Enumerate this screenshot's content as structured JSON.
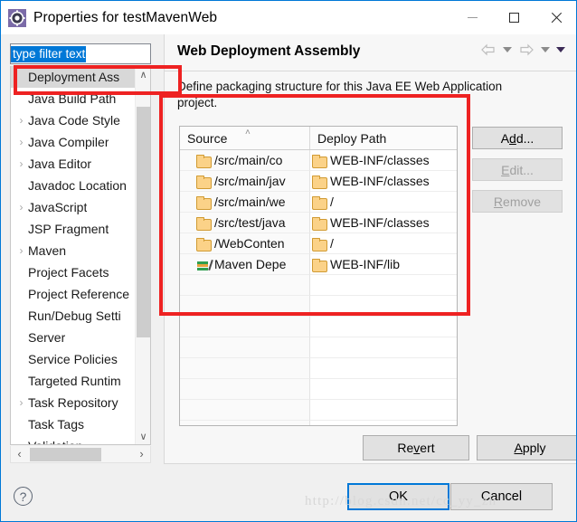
{
  "window": {
    "title": "Properties for testMavenWeb",
    "icon": "gear-icon",
    "minimize_label": "Minimize",
    "maximize_label": "Maximize",
    "close_label": "Close"
  },
  "sidebar": {
    "filter": {
      "value": "type filter text",
      "placeholder": "type filter text"
    },
    "items": [
      {
        "label": "Deployment Ass",
        "expandable": false,
        "selected": true
      },
      {
        "label": "Java Build Path",
        "expandable": false,
        "selected": false
      },
      {
        "label": "Java Code Style",
        "expandable": true,
        "selected": false
      },
      {
        "label": "Java Compiler",
        "expandable": true,
        "selected": false
      },
      {
        "label": "Java Editor",
        "expandable": true,
        "selected": false
      },
      {
        "label": "Javadoc Location",
        "expandable": false,
        "selected": false
      },
      {
        "label": "JavaScript",
        "expandable": true,
        "selected": false
      },
      {
        "label": "JSP Fragment",
        "expandable": false,
        "selected": false
      },
      {
        "label": "Maven",
        "expandable": true,
        "selected": false
      },
      {
        "label": "Project Facets",
        "expandable": false,
        "selected": false
      },
      {
        "label": "Project Reference",
        "expandable": false,
        "selected": false
      },
      {
        "label": "Run/Debug Setti",
        "expandable": false,
        "selected": false
      },
      {
        "label": "Server",
        "expandable": false,
        "selected": false
      },
      {
        "label": "Service Policies",
        "expandable": false,
        "selected": false
      },
      {
        "label": "Targeted Runtim",
        "expandable": false,
        "selected": false
      },
      {
        "label": "Task Repository",
        "expandable": true,
        "selected": false
      },
      {
        "label": "Task Tags",
        "expandable": false,
        "selected": false
      },
      {
        "label": "Validation",
        "expandable": true,
        "selected": false
      }
    ],
    "scroll_up_glyph": "∧",
    "scroll_down_glyph": "∨",
    "scroll_left_glyph": "‹",
    "scroll_right_glyph": "›"
  },
  "page": {
    "title": "Web Deployment Assembly",
    "description": "Define packaging structure for this Java EE Web Application project."
  },
  "table": {
    "columns": [
      "Source",
      "Deploy Path"
    ],
    "sort_indicator": "˄",
    "rows": [
      {
        "source": "/src/main/co",
        "source_icon": "folder-icon",
        "deploy": "WEB-INF/classes",
        "deploy_icon": "folder-icon"
      },
      {
        "source": "/src/main/jav",
        "source_icon": "folder-icon",
        "deploy": "WEB-INF/classes",
        "deploy_icon": "folder-icon"
      },
      {
        "source": "/src/main/we",
        "source_icon": "folder-icon",
        "deploy": "/",
        "deploy_icon": "folder-icon"
      },
      {
        "source": "/src/test/java",
        "source_icon": "folder-icon",
        "deploy": "WEB-INF/classes",
        "deploy_icon": "folder-icon"
      },
      {
        "source": "/WebConten",
        "source_icon": "folder-icon",
        "deploy": "/",
        "deploy_icon": "folder-icon"
      },
      {
        "source": "Maven Depe",
        "source_icon": "maven-icon",
        "deploy": "WEB-INF/lib",
        "deploy_icon": "folder-icon"
      }
    ],
    "empty_row_count": 8
  },
  "buttons": {
    "add": {
      "prefix": "A",
      "mnemonic": "d",
      "suffix": "d...",
      "enabled": true
    },
    "edit": {
      "prefix": "",
      "mnemonic": "E",
      "suffix": "dit...",
      "enabled": false
    },
    "remove": {
      "prefix": "",
      "mnemonic": "R",
      "suffix": "emove",
      "enabled": false
    },
    "revert": {
      "prefix": "Re",
      "mnemonic": "v",
      "suffix": "ert"
    },
    "apply": {
      "prefix": "",
      "mnemonic": "A",
      "suffix": "pply"
    },
    "ok": "OK",
    "cancel": "Cancel"
  },
  "help": {
    "glyph": "?",
    "label": "Help"
  },
  "watermark": "http://blog.csdn.net/cc_yy_zh",
  "colors": {
    "accent": "#0078d7",
    "annotation": "#ee2222",
    "selection": "#0078d7",
    "folder": "#fbd288",
    "panel": "#f0f0f0"
  }
}
